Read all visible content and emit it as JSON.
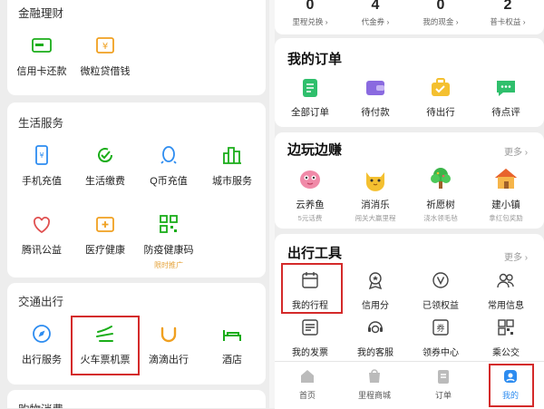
{
  "left": {
    "finance": {
      "title": "金融理财",
      "items": [
        {
          "label": "信用卡还款",
          "icon": "credit-card-icon"
        },
        {
          "label": "微粒贷借钱",
          "icon": "loan-icon"
        }
      ]
    },
    "life": {
      "title": "生活服务",
      "items": [
        {
          "label": "手机充值",
          "icon": "phone-icon"
        },
        {
          "label": "生活缴费",
          "icon": "bill-icon"
        },
        {
          "label": "Q币充值",
          "icon": "qq-icon"
        },
        {
          "label": "城市服务",
          "icon": "city-icon"
        },
        {
          "label": "腾讯公益",
          "icon": "charity-icon"
        },
        {
          "label": "医疗健康",
          "icon": "medical-icon"
        },
        {
          "label": "防疫健康码",
          "icon": "qr-code-icon",
          "sub": "限时推广"
        }
      ]
    },
    "transport": {
      "title": "交通出行",
      "items": [
        {
          "label": "出行服务",
          "icon": "compass-icon"
        },
        {
          "label": "火车票机票",
          "icon": "train-icon"
        },
        {
          "label": "滴滴出行",
          "icon": "didi-icon"
        },
        {
          "label": "酒店",
          "icon": "hotel-icon"
        }
      ]
    },
    "shopping": {
      "title": "购物消费"
    }
  },
  "right": {
    "stats": [
      {
        "value": "0",
        "label": "里程兑换 ›"
      },
      {
        "value": "4",
        "label": "代金券 ›"
      },
      {
        "value": "0",
        "label": "我的现金 ›"
      },
      {
        "value": "2",
        "label": "普卡权益 ›"
      }
    ],
    "orders": {
      "title": "我的订单",
      "items": [
        {
          "label": "全部订单",
          "icon": "document-icon"
        },
        {
          "label": "待付款",
          "icon": "wallet-icon"
        },
        {
          "label": "待出行",
          "icon": "suitcase-icon"
        },
        {
          "label": "待点评",
          "icon": "comment-icon"
        }
      ]
    },
    "games": {
      "title": "边玩边赚",
      "more": "更多 ›",
      "items": [
        {
          "label": "云养鱼",
          "sub": "5元话费",
          "icon": "fish-icon"
        },
        {
          "label": "消消乐",
          "sub": "闯关大赢里程",
          "icon": "cat-icon"
        },
        {
          "label": "祈愿树",
          "sub": "浇水领毛毡",
          "icon": "tree-icon"
        },
        {
          "label": "建小镇",
          "sub": "拿红包奖励",
          "icon": "house-icon"
        }
      ]
    },
    "tools": {
      "title": "出行工具",
      "more": "更多 ›",
      "items": [
        {
          "label": "我的行程",
          "icon": "calendar-icon"
        },
        {
          "label": "信用分",
          "icon": "badge-icon"
        },
        {
          "label": "已领权益",
          "icon": "coupon-v-icon"
        },
        {
          "label": "常用信息",
          "icon": "contacts-icon"
        },
        {
          "label": "我的发票",
          "icon": "invoice-icon"
        },
        {
          "label": "我的客服",
          "icon": "service-icon"
        },
        {
          "label": "领券中心",
          "icon": "ticket-icon"
        },
        {
          "label": "乘公交",
          "icon": "bus-icon"
        }
      ]
    },
    "tabbar": [
      {
        "label": "首页",
        "icon": "home-icon"
      },
      {
        "label": "里程商城",
        "icon": "mall-icon"
      },
      {
        "label": "订单",
        "icon": "order-icon"
      },
      {
        "label": "我的",
        "icon": "profile-icon"
      }
    ]
  },
  "colors": {
    "accent_green": "#1aad19",
    "highlight_red": "#d42a2a",
    "orange": "#f0a020"
  }
}
